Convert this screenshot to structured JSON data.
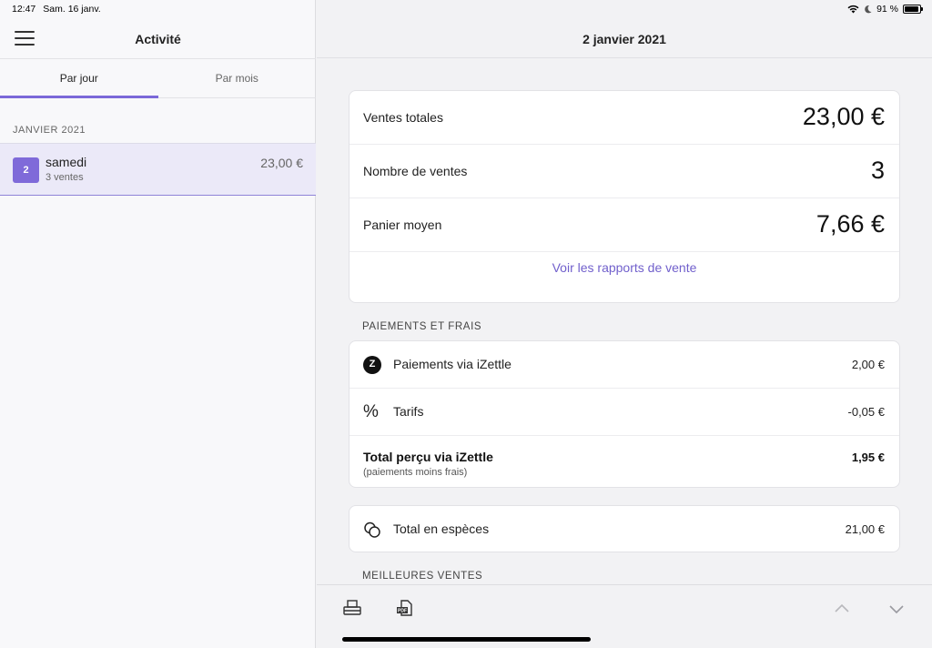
{
  "status": {
    "time": "12:47",
    "date": "Sam. 16 janv.",
    "battery": "91 %"
  },
  "sidebar": {
    "title": "Activité",
    "tabs": [
      {
        "label": "Par jour",
        "active": true
      },
      {
        "label": "Par mois",
        "active": false
      }
    ],
    "group_label": "JANVIER 2021",
    "items": [
      {
        "badge": "2",
        "day": "samedi",
        "sales_count": "3 ventes",
        "amount": "23,00 €"
      }
    ]
  },
  "detail": {
    "title": "2 janvier 2021",
    "summary": [
      {
        "label": "Ventes totales",
        "value": "23,00 €"
      },
      {
        "label": "Nombre de ventes",
        "value": "3"
      },
      {
        "label": "Panier moyen",
        "value": "7,66 €"
      }
    ],
    "report_link": "Voir les rapports de vente",
    "payments_section_label": "PAIEMENTS ET FRAIS",
    "payments": [
      {
        "icon": "izettle-icon",
        "icon_text": "Z",
        "label": "Paiements via iZettle",
        "value": "2,00 €"
      },
      {
        "icon": "percent-icon",
        "icon_text": "%",
        "label": "Tarifs",
        "value": "-0,05 €"
      }
    ],
    "total": {
      "label": "Total perçu via iZettle",
      "sub": "(paiements moins frais)",
      "value": "1,95 €"
    },
    "cash": {
      "icon": "coins-icon",
      "label": "Total en espèces",
      "value": "21,00 €"
    },
    "best_sellers_label": "MEILLEURES VENTES"
  },
  "colors": {
    "accent": "#7b68d8",
    "link": "#7160cc",
    "selected_bg": "#ebe9f8"
  }
}
